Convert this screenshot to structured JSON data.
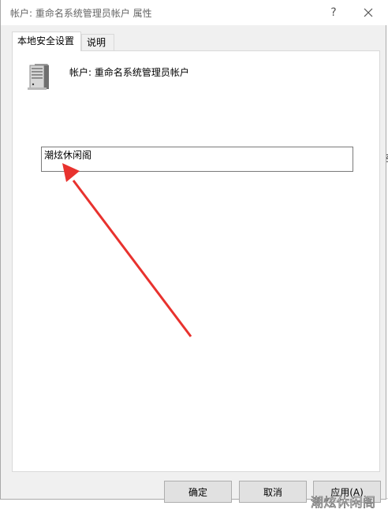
{
  "window": {
    "title": "帐户: 重命名系统管理员帐户 属性",
    "help_glyph": "?",
    "close_icon": "close-icon"
  },
  "tabs": [
    {
      "label": "本地安全设置"
    },
    {
      "label": "说明"
    }
  ],
  "panel": {
    "account_label": "帐户: 重命名系统管理员帐户",
    "account_name_value": "潮炫休闲阁",
    "icon": "server-icon"
  },
  "buttons": {
    "ok": "确定",
    "cancel": "取消",
    "apply": "应用(A)"
  },
  "annotation": {
    "color": "#e8322e"
  },
  "watermark": "潮炫休闲阁"
}
